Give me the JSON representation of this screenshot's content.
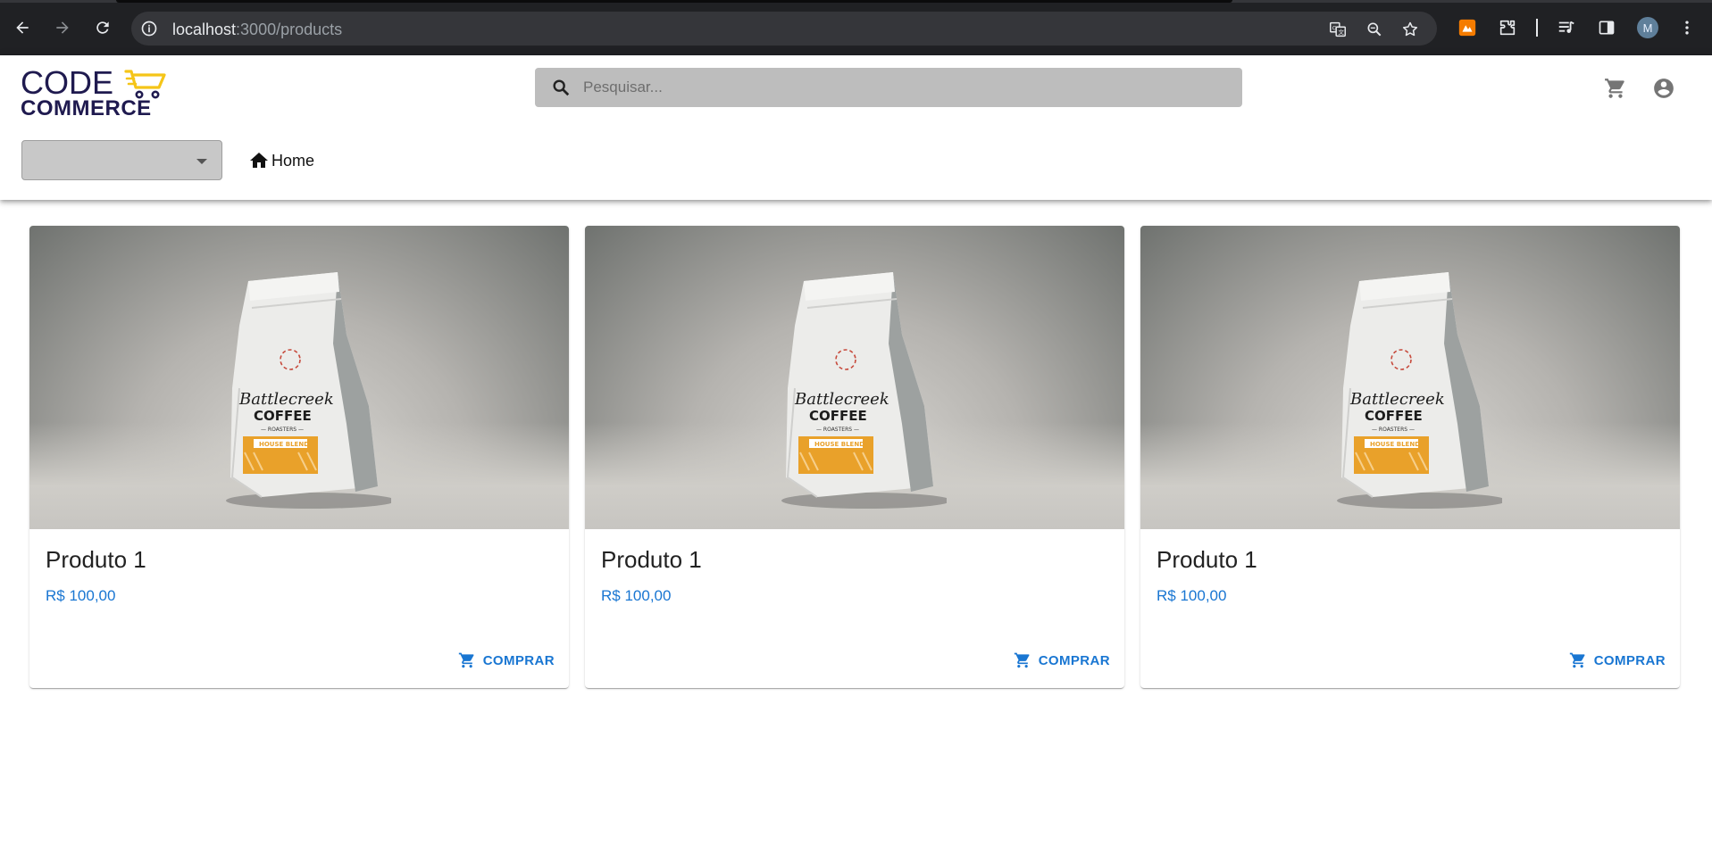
{
  "browser": {
    "url_host": "localhost",
    "url_path": ":3000/products",
    "profile_initial": "M"
  },
  "header": {
    "logo": {
      "line1": "CODE",
      "line2": "COMMERCE"
    },
    "search": {
      "placeholder": "Pesquisar..."
    },
    "category_select": {
      "value": ""
    },
    "home_label": "Home"
  },
  "products": [
    {
      "name": "Produto 1",
      "price": "R$ 100,00",
      "buy_label": "COMPRAR",
      "image": "coffee-bag"
    },
    {
      "name": "Produto 1",
      "price": "R$ 100,00",
      "buy_label": "COMPRAR",
      "image": "coffee-bag"
    },
    {
      "name": "Produto 1",
      "price": "R$ 100,00",
      "buy_label": "COMPRAR",
      "image": "coffee-bag"
    }
  ],
  "colors": {
    "brand_navy": "#1f1a4f",
    "brand_yellow": "#f5c518",
    "primary": "#1976d2",
    "search_bg": "#bdbdbd",
    "chrome_bg": "#202124"
  }
}
